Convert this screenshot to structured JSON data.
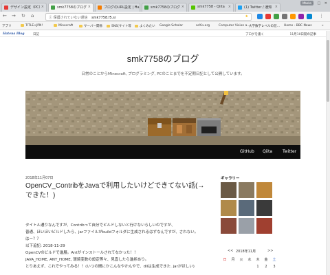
{
  "browser": {
    "tabs": [
      {
        "title": "デザイン設定（PC）",
        "color": "#e53935"
      },
      {
        "title": "smk7758のブログ",
        "color": "#43a047"
      },
      {
        "title": "ブログのURL設定 | Ha…",
        "color": "#f57c00"
      },
      {
        "title": "smk7758のブログ",
        "color": "#43a047"
      },
      {
        "title": "smk7758 - Qiita",
        "color": "#55c500"
      },
      {
        "title": "(1) Twitter / 通知",
        "color": "#1da1f2"
      }
    ],
    "profile": "Mboko",
    "omnibox_security": "保護されていない通信",
    "omnibox_url": "smk7758.f5.si",
    "bookmarks": [
      {
        "label": "アプリ",
        "kind": "apps"
      },
      {
        "label": "TITLE+JPN!",
        "kind": "folder"
      },
      {
        "label": "Minecraft",
        "kind": "folder"
      },
      {
        "label": "サーバー関係",
        "kind": "folder"
      },
      {
        "label": "SNS(サイト等",
        "kind": "folder"
      },
      {
        "label": "よくみたい",
        "kind": "folder"
      },
      {
        "label": "Google Scholar",
        "kind": "site"
      },
      {
        "label": "arXiv.org",
        "kind": "site"
      },
      {
        "label": "Computer Vision a…",
        "kind": "site"
      },
      {
        "label": "大学数学レベルの記…",
        "kind": "site"
      },
      {
        "label": "Home - BBC News",
        "kind": "site"
      },
      {
        "label": "»",
        "kind": "more"
      }
    ]
  },
  "hatena": {
    "logo": "Hatena Blog",
    "diary": "日記",
    "write": "ブログを書く",
    "date_notice": "11月10日開の記事"
  },
  "blog": {
    "title": "smk7758のブログ",
    "description": "日常のことからMinecraft, プログラミング, PCのことまでを不定期日記として公開しています。",
    "nav": [
      "GitHub",
      "Qiita",
      "Twitter"
    ]
  },
  "post": {
    "date": "2018年11月07日",
    "title": "OpenCV_ContribをJavaで利用したいけどできてない話(→できた！)",
    "paragraphs": [
      "タイトル通りなんですが、Contribって自分でビルドしないと行けないらしいのですが、",
      "普通、ほいほいビルドしたら、jarファイルがbuildフォルダに生成されるはずなんですが、されない。",
      "はー？？",
      "",
      "以下追記: 2018-11-29",
      "OpenCVのビルドで進展。Antがインストールされてなかった！！",
      "JAVA_HOME, ANT_HOME, 環境変数の設定等々、見直したら進捗あり。",
      "とりあえず、これでやってみる！！(いつの間にかこんなやかんやで、dllは生成できた. jarがほしい)"
    ]
  },
  "sidebar": {
    "gallery_title": "ギャラリー",
    "calendar_title": "2018年11月",
    "calendar_prev": "<<",
    "calendar_next": ">>",
    "weekdays": [
      "日",
      "月",
      "火",
      "水",
      "木",
      "金",
      "土"
    ],
    "first_week": [
      "",
      "",
      "",
      "",
      "1",
      "2",
      "3"
    ]
  }
}
